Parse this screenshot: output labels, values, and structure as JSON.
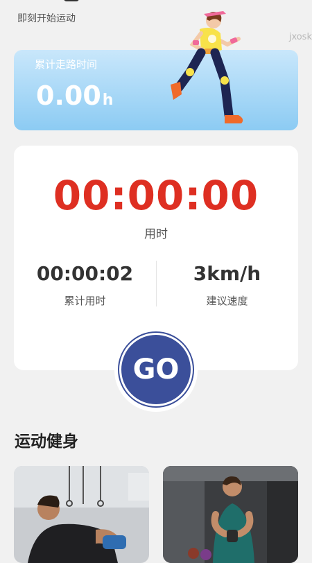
{
  "header": {
    "subtitle": "即刻开始运动",
    "watermark": "jxosk"
  },
  "walk_card": {
    "label": "累计走路时间",
    "value": "0.00",
    "unit": "h"
  },
  "timer": {
    "main_time": "00:00:00",
    "main_label": "用时",
    "total_time_value": "00:00:02",
    "total_time_label": "累计用时",
    "speed_value": "3km/h",
    "speed_label": "建议速度"
  },
  "go_button": {
    "label": "GO"
  },
  "fitness_section": {
    "title": "运动健身"
  },
  "colors": {
    "timer_red": "#de2f22",
    "go_blue": "#3b4f9a",
    "card_blue": "#8ccbf3"
  }
}
